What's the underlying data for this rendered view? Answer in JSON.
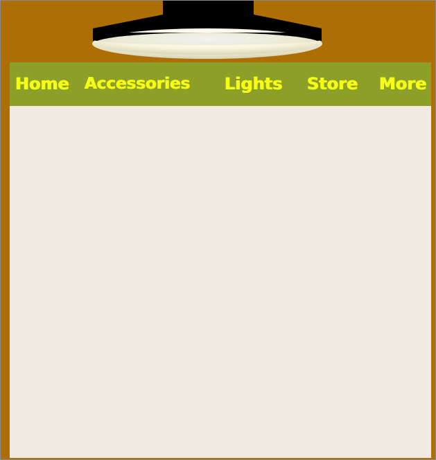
{
  "nav": {
    "items": [
      {
        "label": "Home"
      },
      {
        "label": "Accessories"
      },
      {
        "label": "Lights"
      },
      {
        "label": "Store"
      },
      {
        "label": "More"
      }
    ]
  },
  "colors": {
    "background": "#ad6e05",
    "nav_bar": "#8d9e29",
    "nav_text": "#f5ff15",
    "content_panel": "#f1eae2",
    "lamp_shade": "#000000",
    "lamp_glow": "#fdfbe8"
  }
}
